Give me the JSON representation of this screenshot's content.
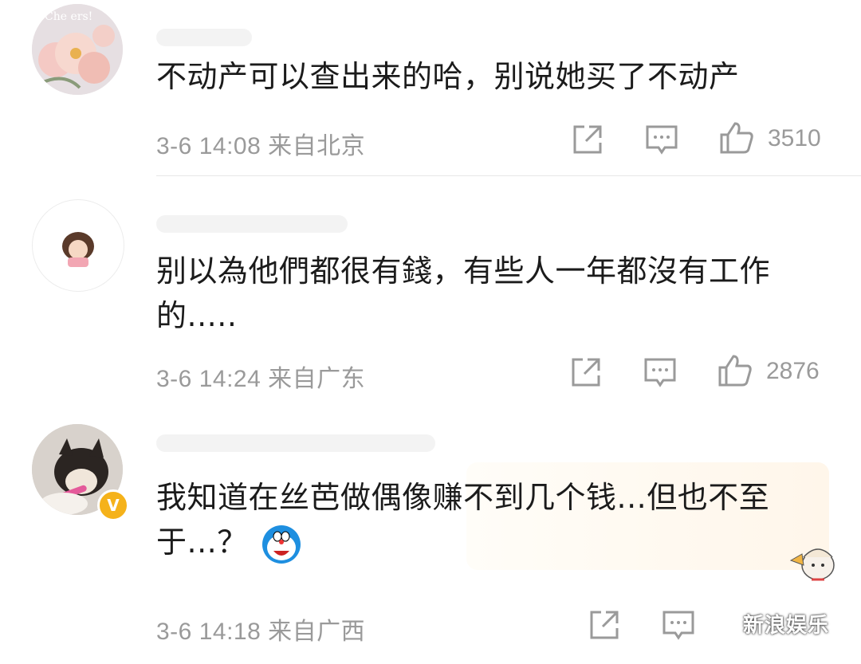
{
  "comments": [
    {
      "text": "不动产可以查出来的哈，别说她买了不动产",
      "time": "3-6 14:08",
      "location": "来自北京",
      "likes": "3510"
    },
    {
      "text": "别以為他們都很有錢，有些人一年都沒有工作的.....",
      "time": "3-6 14:24",
      "location": "来自广东",
      "likes": "2876"
    },
    {
      "text": "我知道在丝芭做偶像赚不到几个钱...但也不至于...？",
      "time": "3-6 14:18",
      "location": "来自广西",
      "likes": "",
      "verified_badge": "V"
    }
  ],
  "avatar_text": "Che  ers!",
  "watermark": "新浪娱乐",
  "icons": [
    "share-icon",
    "comment-icon",
    "like-icon",
    "doraemon-emoji",
    "wechat-icon"
  ],
  "colors": {
    "meta": "#9a9a9a",
    "badge": "#f5b21a",
    "divider": "#e8e8e8"
  }
}
